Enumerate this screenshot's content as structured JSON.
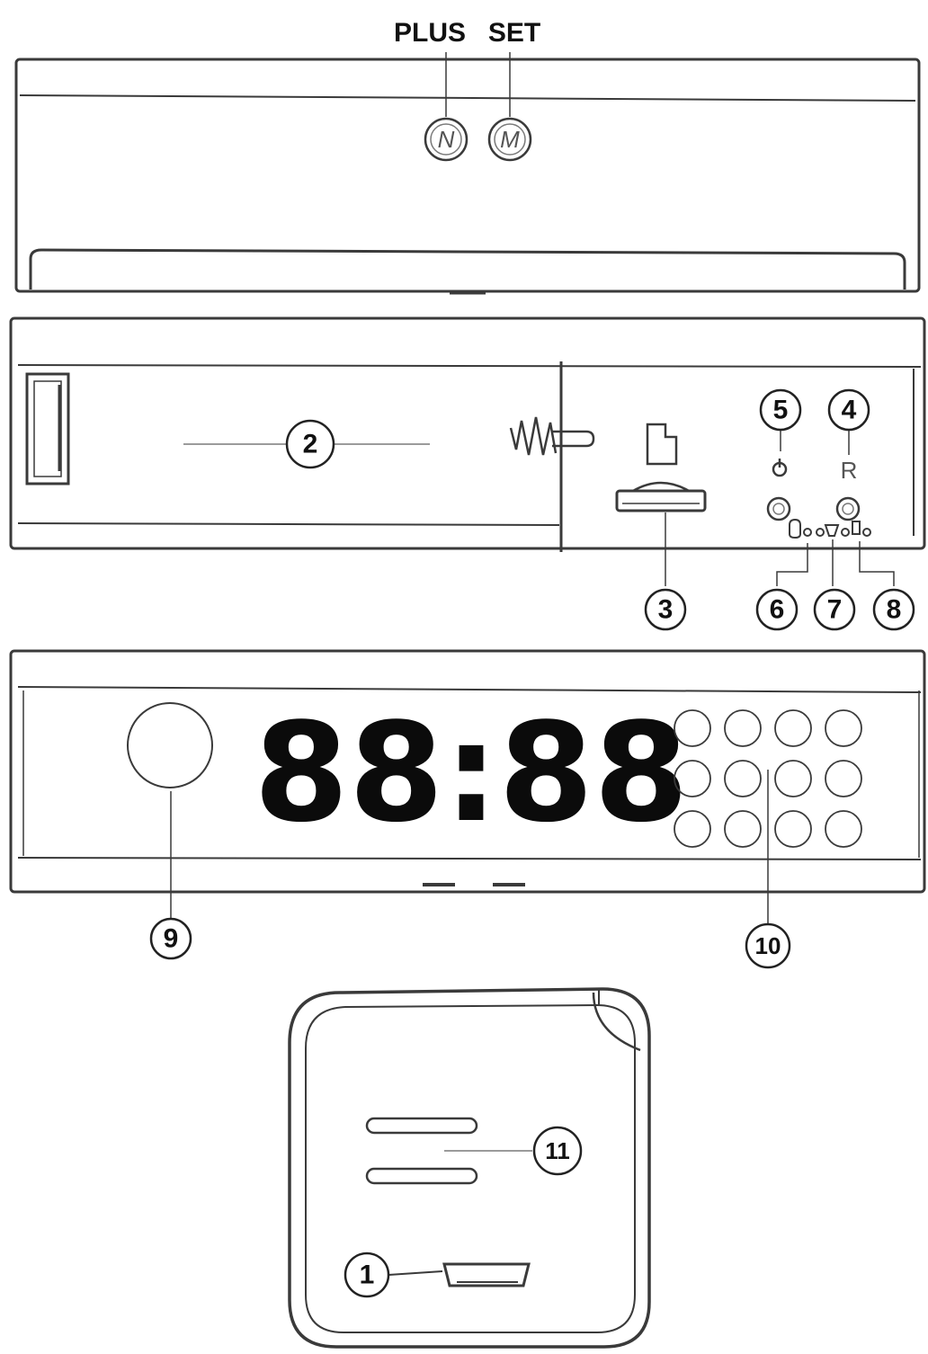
{
  "top_buttons": {
    "plus_label": "PLUS",
    "set_label": "SET",
    "plus_letter": "N",
    "set_letter": "M"
  },
  "display": {
    "clock_text": "88:88"
  },
  "side_panel": {
    "reset_letter": "R"
  },
  "callouts": {
    "c1": "1",
    "c2": "2",
    "c3": "3",
    "c4": "4",
    "c5": "5",
    "c6": "6",
    "c7": "7",
    "c8": "8",
    "c9": "9",
    "c10": "10",
    "c11": "11"
  }
}
